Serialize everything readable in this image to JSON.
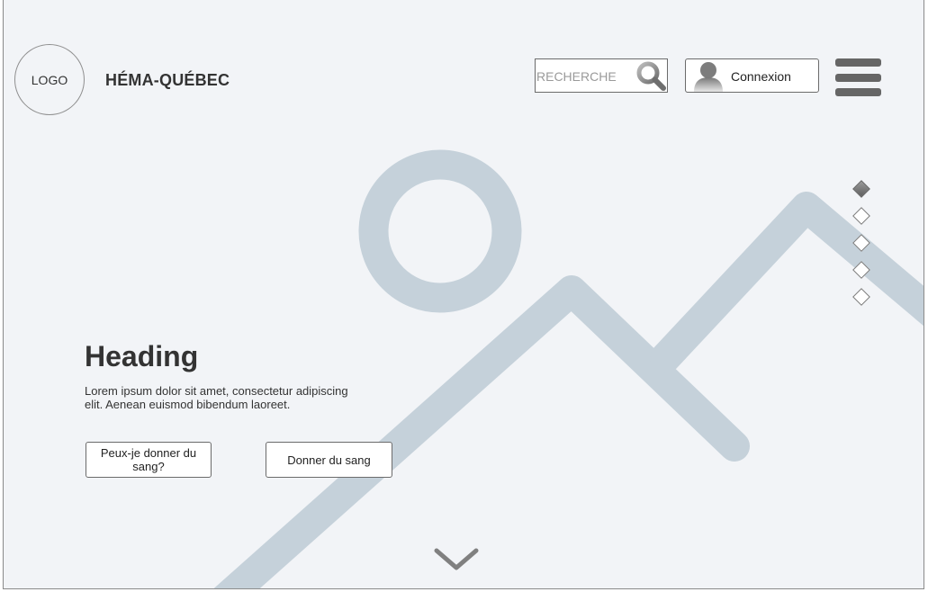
{
  "header": {
    "logo_text": "LOGO",
    "brand_name": "HÉMA-QUÉBEC",
    "search": {
      "placeholder": "RECHERCHE",
      "value": "",
      "icon": "search-icon"
    },
    "login": {
      "label": "Connexion",
      "icon": "user-avatar-icon"
    },
    "menu_icon": "hamburger-menu-icon"
  },
  "hero": {
    "heading": "Heading",
    "text": "Lorem ipsum dolor sit amet, consectetur adipiscing elit. Aenean euismod bibendum laoreet.",
    "buttons": [
      {
        "label": "Peux-je donner du sang?"
      },
      {
        "label": "Donner du sang"
      }
    ],
    "image_placeholder_icon": "image-placeholder-icon",
    "scroll_icon": "chevron-down-icon"
  },
  "carousel": {
    "slide_count": 5,
    "active_index": 0
  },
  "colors": {
    "background": "#f2f4f7",
    "placeholder_graphic": "#c5d1da",
    "menu_bars": "#666666",
    "text": "#333333"
  }
}
